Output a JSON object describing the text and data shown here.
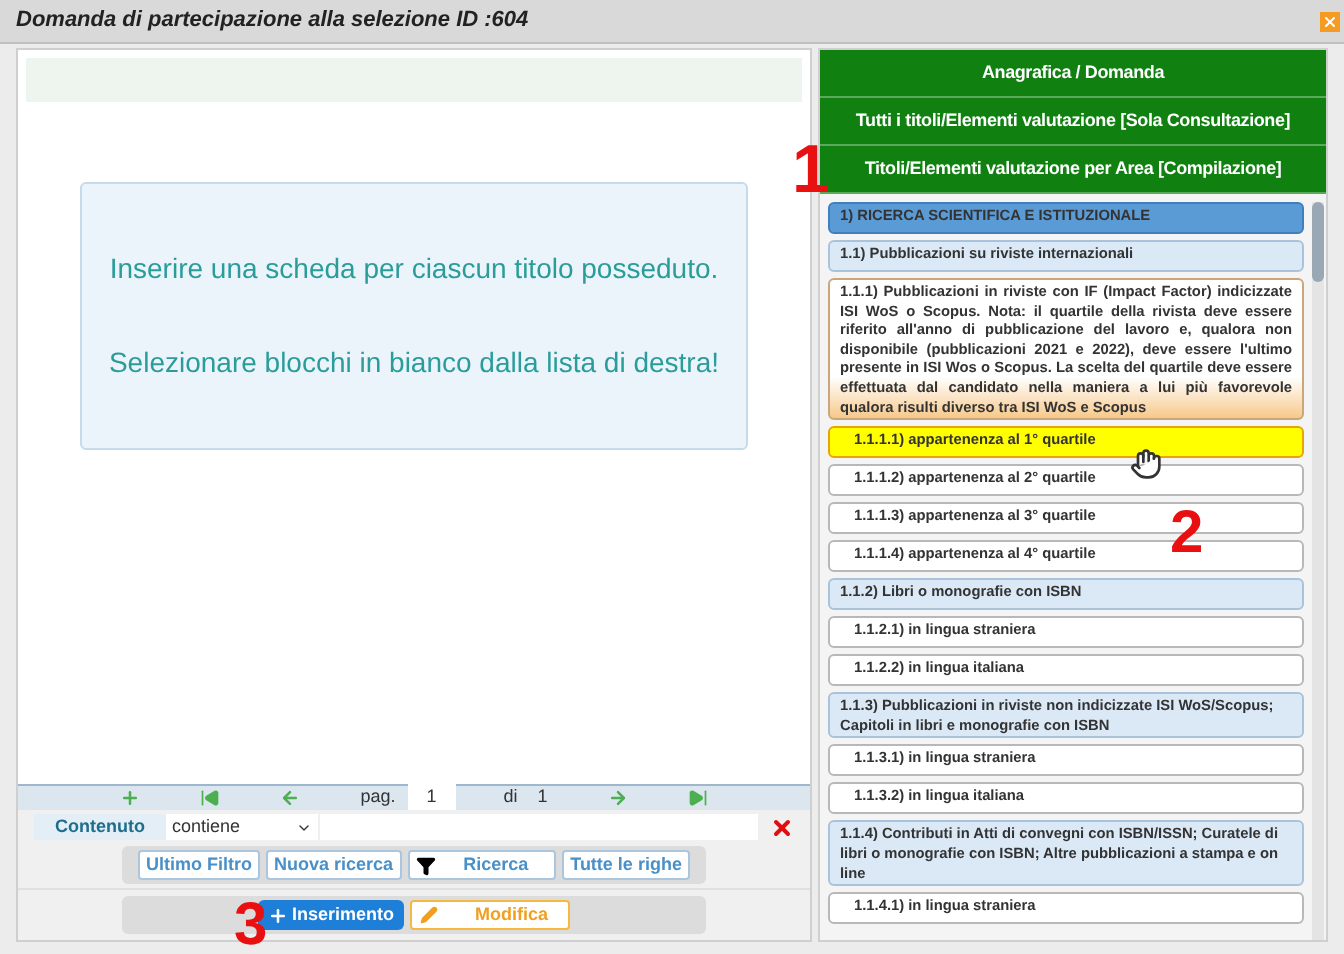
{
  "window": {
    "title": "Domanda di partecipazione alla selezione ID :604"
  },
  "info": {
    "lines": [
      "Inserire una scheda per ciascun titolo posseduto.",
      "Selezionare blocchi in bianco dalla lista di destra!"
    ]
  },
  "pager": {
    "page_label": "pag.",
    "page": "1",
    "of_label": "di",
    "total": "1"
  },
  "filter": {
    "field": "Contenuto",
    "operator": "contiene"
  },
  "filter_buttons": [
    {
      "label": "Ultimo Filtro",
      "kind": "plain"
    },
    {
      "label": "Nuova ricerca",
      "kind": "plain"
    },
    {
      "label": "Ricerca",
      "kind": "funnel"
    },
    {
      "label": "Tutte le righe",
      "kind": "plain"
    }
  ],
  "actions": [
    {
      "label": "Inserimento",
      "kind": "insert"
    },
    {
      "label": "Modifica",
      "kind": "edit"
    }
  ],
  "nav": [
    {
      "label": "Anagrafica / Domanda"
    },
    {
      "label": "Tutti i titoli/Elementi valutazione [Sola Consultazione]"
    },
    {
      "label": "Titoli/Elementi valutazione per Area [Compilazione]"
    }
  ],
  "items": [
    {
      "label": "1) RICERCA SCIENTIFICA E ISTITUZIONALE",
      "kind": "section",
      "selected": false
    },
    {
      "label": "1.1) Pubblicazioni su riviste internazionali",
      "kind": "group",
      "selected": false
    },
    {
      "label": "1.1.1) Pubblicazioni in riviste con IF (Impact Factor) indicizzate ISI WoS o Scopus. Nota: il quartile della rivista deve essere riferito all'anno di pubblicazione del lavoro e, qualora non disponibile (pubblicazioni 2021 e 2022), deve essere l'ultimo presente in ISI Wos o Scopus. La scelta del quartile deve essere effettuata dal candidato nella maniera a lui più favorevole qualora risulti diverso tra ISI WoS e Scopus",
      "kind": "note",
      "selected": false
    },
    {
      "label": "1.1.1.1) appartenenza al 1° quartile",
      "kind": "leaf",
      "selected": true
    },
    {
      "label": "1.1.1.2) appartenenza al 2° quartile",
      "kind": "leaf",
      "selected": false
    },
    {
      "label": "1.1.1.3) appartenenza al 3° quartile",
      "kind": "leaf",
      "selected": false
    },
    {
      "label": "1.1.1.4) appartenenza al 4° quartile",
      "kind": "leaf",
      "selected": false
    },
    {
      "label": "1.1.2) Libri o monografie con ISBN",
      "kind": "group",
      "selected": false
    },
    {
      "label": "1.1.2.1) in lingua straniera",
      "kind": "leaf",
      "selected": false
    },
    {
      "label": "1.1.2.2) in lingua italiana",
      "kind": "leaf",
      "selected": false
    },
    {
      "label": "1.1.3) Pubblicazioni in riviste non indicizzate ISI WoS/Scopus; Capitoli in libri e monografie con ISBN",
      "kind": "group",
      "selected": false
    },
    {
      "label": "1.1.3.1) in lingua straniera",
      "kind": "leaf",
      "selected": false
    },
    {
      "label": "1.1.3.2) in lingua italiana",
      "kind": "leaf",
      "selected": false
    },
    {
      "label": "1.1.4) Contributi in Atti di convegni con ISBN/ISSN; Curatele di libri o monografie con ISBN; Altre pubblicazioni a stampa e on line",
      "kind": "group",
      "selected": false
    },
    {
      "label": "1.1.4.1) in lingua straniera",
      "kind": "leaf",
      "selected": false
    }
  ],
  "annotations": [
    "1",
    "2",
    "3"
  ]
}
